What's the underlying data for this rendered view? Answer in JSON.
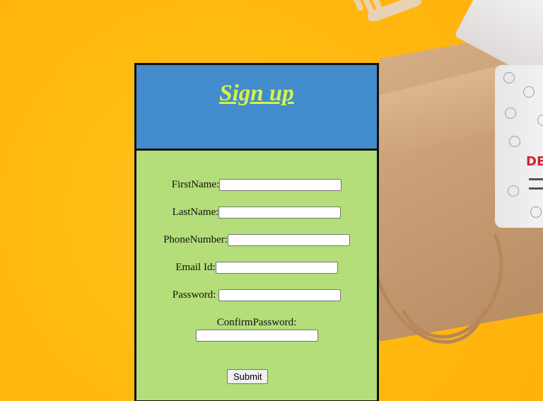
{
  "form": {
    "title": "Sign up",
    "fields": {
      "first_name": {
        "label": "FirstName:",
        "value": ""
      },
      "last_name": {
        "label": "LastName:",
        "value": ""
      },
      "phone_number": {
        "label": "PhoneNumber:",
        "value": ""
      },
      "email": {
        "label": "Email Id:",
        "value": ""
      },
      "password": {
        "label": "Password:",
        "value": ""
      },
      "confirm_password": {
        "label": "ConfirmPassword:",
        "value": ""
      }
    },
    "submit_label": "Submit"
  },
  "background": {
    "color": "#ffba10",
    "box_logo_text": "DE"
  },
  "colors": {
    "header": "#438ccb",
    "body": "#b3de79",
    "title": "#d7f34a"
  }
}
